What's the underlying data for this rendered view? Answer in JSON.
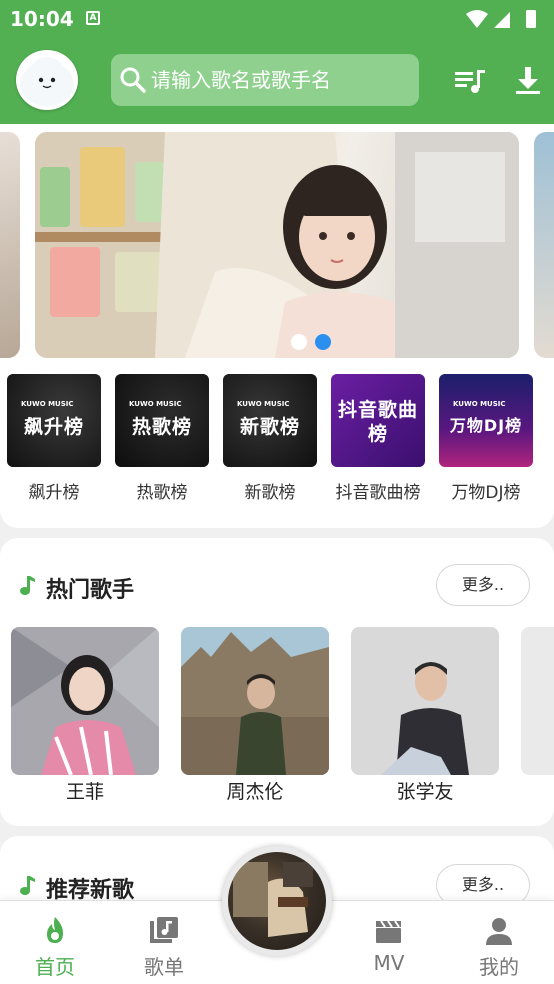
{
  "status": {
    "time": "10:04",
    "badge": "A"
  },
  "header": {
    "search_placeholder": "请输入歌名或歌手名",
    "playlist_icon": "playlist-icon",
    "download_icon": "download-icon"
  },
  "banner": {
    "pages": 2,
    "active_page": 2
  },
  "ranks": [
    {
      "cover_text": "飙升榜",
      "brand": "KUWO MUSIC",
      "name": "飙升榜"
    },
    {
      "cover_text": "热歌榜",
      "brand": "KUWO MUSIC",
      "name": "热歌榜"
    },
    {
      "cover_text": "新歌榜",
      "brand": "KUWO MUSIC",
      "name": "新歌榜"
    },
    {
      "cover_text": "抖音歌曲榜",
      "brand": "",
      "name": "抖音歌曲榜"
    },
    {
      "cover_text": "万物DJ榜",
      "brand": "KUWO MUSIC",
      "name": "万物DJ榜"
    }
  ],
  "hot_singers": {
    "title": "热门歌手",
    "more": "更多..",
    "items": [
      {
        "name": "王菲"
      },
      {
        "name": "周杰伦"
      },
      {
        "name": "张学友"
      }
    ]
  },
  "new_songs": {
    "title": "推荐新歌",
    "more": "更多.."
  },
  "nav": {
    "items": [
      {
        "label": "首页",
        "active": true
      },
      {
        "label": "歌单",
        "active": false
      },
      {
        "label": "MV",
        "active": false
      },
      {
        "label": "我的",
        "active": false
      }
    ]
  },
  "colors": {
    "primary": "#52b052",
    "active_nav": "#4caf50"
  }
}
